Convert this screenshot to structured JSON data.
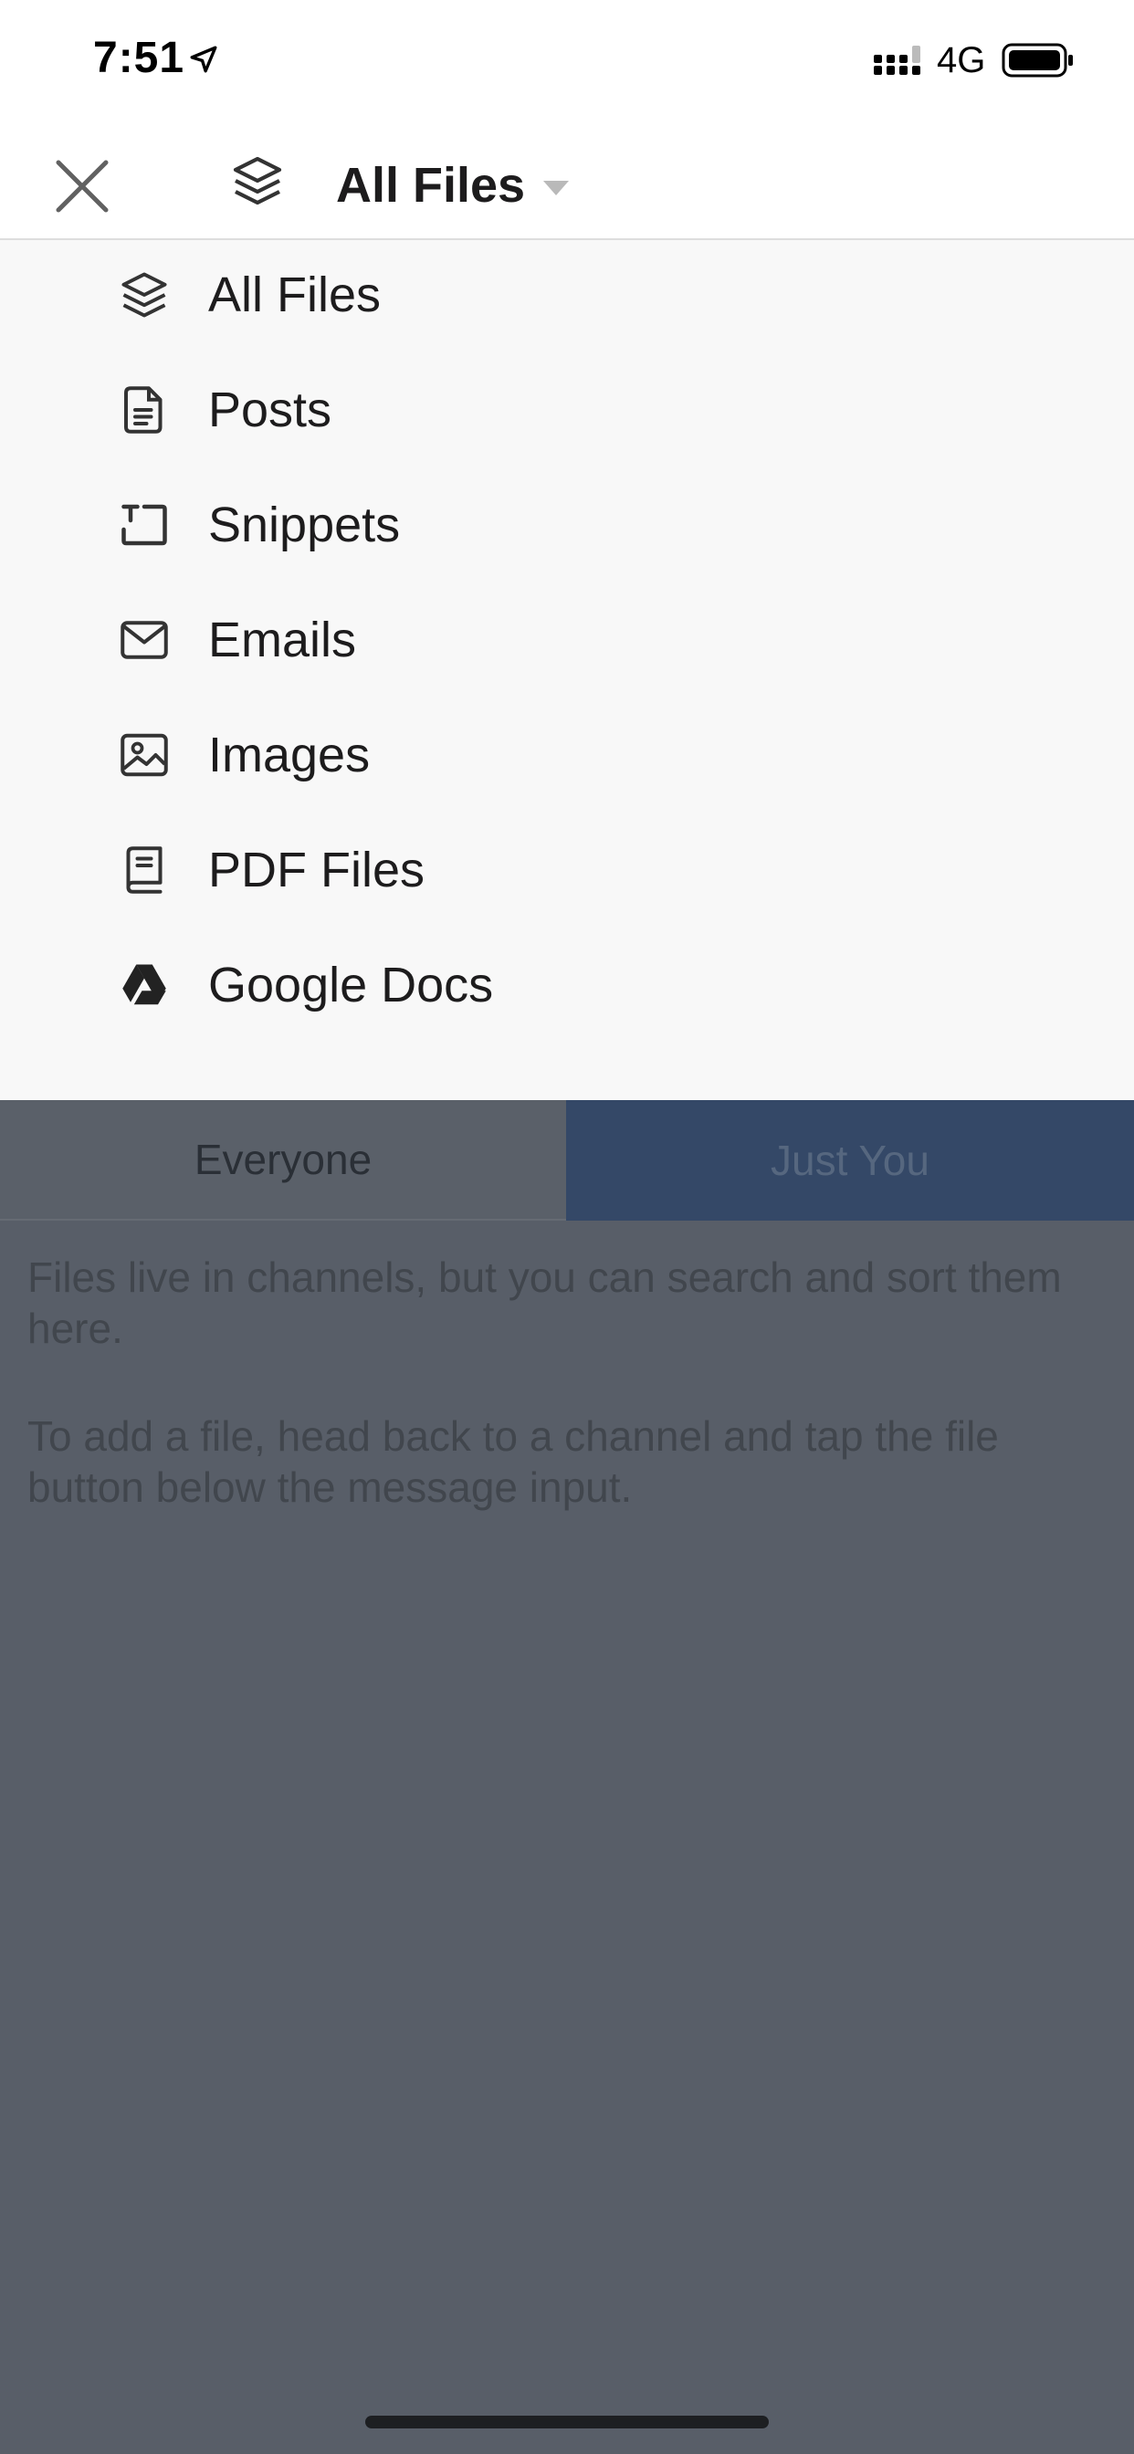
{
  "status_bar": {
    "time": "7:51",
    "network": "4G"
  },
  "header": {
    "title": "All Files",
    "close_icon": "close-icon",
    "type_icon": "layers-icon",
    "caret_icon": "caret-down-icon"
  },
  "menu": {
    "items": [
      {
        "label": "All Files",
        "icon": "layers-icon"
      },
      {
        "label": "Posts",
        "icon": "document-icon"
      },
      {
        "label": "Snippets",
        "icon": "snippet-icon"
      },
      {
        "label": "Emails",
        "icon": "envelope-icon"
      },
      {
        "label": "Images",
        "icon": "image-icon"
      },
      {
        "label": "PDF Files",
        "icon": "pdf-book-icon"
      },
      {
        "label": "Google Docs",
        "icon": "google-drive-icon"
      }
    ]
  },
  "filter_tabs": {
    "everyone": "Everyone",
    "just_you": "Just You",
    "selected": "Just You"
  },
  "empty_state": {
    "line1": "Files live in channels, but you can search and sort them here.",
    "line2": "To add a file, head back to a channel and tap the file button below the message input."
  },
  "colors": {
    "backdrop": "#585e68",
    "selected_tab": "#344867",
    "menu_bg": "#f8f8f8"
  }
}
